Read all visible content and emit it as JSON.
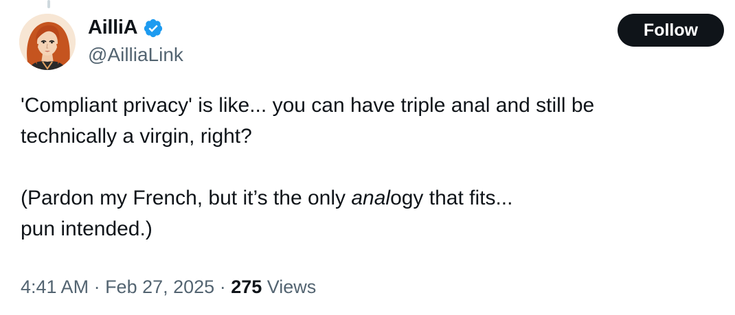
{
  "author": {
    "display_name": "AilliA",
    "handle": "@AilliaLink",
    "verified": true,
    "avatar_icon": "avatar-portrait-icon"
  },
  "actions": {
    "follow_label": "Follow"
  },
  "tweet": {
    "line1_part1": "'Compliant privacy' is like... you can have triple anal and still be",
    "line1_part2": "technically a virgin, right?",
    "line2_pre": "(Pardon my French, but it’s the only ",
    "line2_italic": "anal",
    "line2_post": "ogy that fits...",
    "line3": "pun intended.)"
  },
  "meta": {
    "time": "4:41 AM",
    "separator": " · ",
    "date": "Feb 27, 2025",
    "views_count": "275",
    "views_label": " Views"
  },
  "colors": {
    "text": "#0f1419",
    "secondary": "#536471",
    "verified": "#1d9bf0",
    "follow_bg": "#0f1419"
  }
}
